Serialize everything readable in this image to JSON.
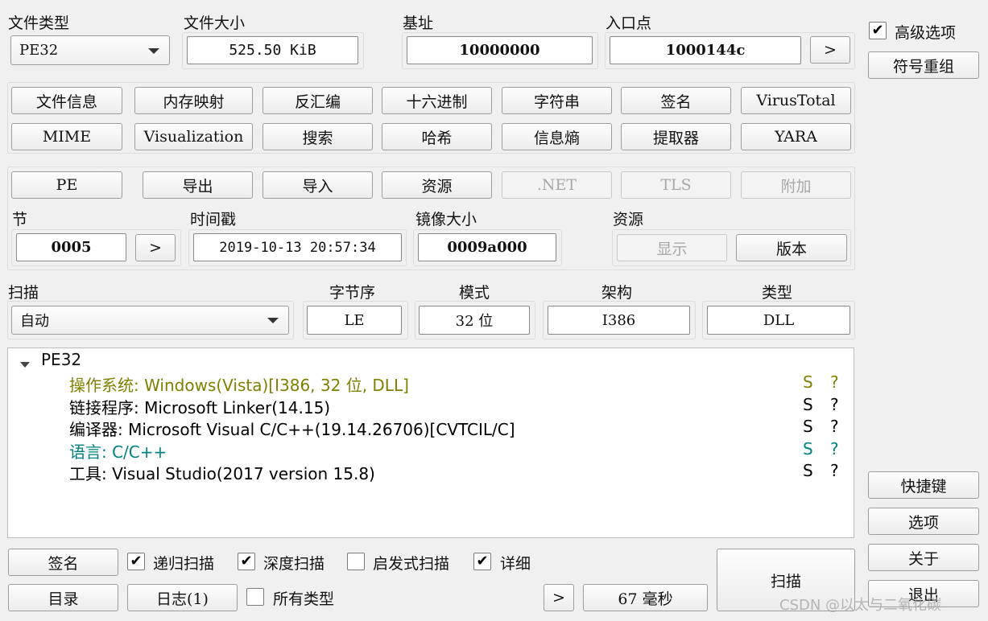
{
  "top": {
    "file_type_label": "文件类型",
    "file_type_value": "PE32",
    "file_size_label": "文件大小",
    "file_size_value": "525.50 KiB",
    "base_label": "基址",
    "base_value": "10000000",
    "entry_label": "入口点",
    "entry_value": "1000144c",
    "entry_go": ">"
  },
  "tools_row1": [
    "文件信息",
    "内存映射",
    "反汇编",
    "十六进制",
    "字符串",
    "签名",
    "VirusTotal"
  ],
  "tools_row2": [
    "MIME",
    "Visualization",
    "搜索",
    "哈希",
    "信息熵",
    "提取器",
    "YARA"
  ],
  "pe_row": {
    "pe": "PE",
    "export": "导出",
    "import": "导入",
    "resources": "资源",
    "net": ".NET",
    "tls": "TLS",
    "overlay": "附加"
  },
  "pe_info": {
    "section_label": "节",
    "section_value": "0005",
    "section_go": ">",
    "time_label": "时间戳",
    "time_value": "2019-10-13 20:57:34",
    "image_label": "镜像大小",
    "image_value": "0009a000",
    "res_label": "资源",
    "res_show": "显示",
    "res_version": "版本"
  },
  "scan": {
    "scan_label": "扫描",
    "scan_value": "自动",
    "endian_label": "字节序",
    "endian_value": "LE",
    "mode_label": "模式",
    "mode_value": "32 位",
    "arch_label": "架构",
    "arch_value": "I386",
    "type_label": "类型",
    "type_value": "DLL"
  },
  "tree": {
    "root": "PE32",
    "items": [
      {
        "text": "操作系统: Windows(Vista)[I386, 32 位, DLL]",
        "color": "#808000",
        "s": "S",
        "q": "?"
      },
      {
        "text": "链接程序: Microsoft Linker(14.15)",
        "color": "#000000",
        "s": "S",
        "q": "?"
      },
      {
        "text": "编译器: Microsoft Visual C/C++(19.14.26706)[CVTCIL/C]",
        "color": "#000000",
        "s": "S",
        "q": "?"
      },
      {
        "text": "语言: C/C++",
        "color": "#008080",
        "s": "S",
        "q": "?"
      },
      {
        "text": "工具: Visual Studio(2017 version 15.8)",
        "color": "#000000",
        "s": "S",
        "q": "?"
      }
    ]
  },
  "bottom": {
    "signature": "签名",
    "recursive": "递归扫描",
    "deep": "深度扫描",
    "heuristic": "启发式扫描",
    "verbose": "详细",
    "directory": "目录",
    "log": "日志(1)",
    "all_types": "所有类型",
    "go": ">",
    "time": "67 毫秒",
    "scan": "扫描",
    "check": "✔"
  },
  "side": {
    "advanced": "高级选项",
    "symbol": "符号重组",
    "shortcuts": "快捷键",
    "options": "选项",
    "about": "关于",
    "exit": "退出"
  },
  "watermark": "CSDN @以太与二氧化碳"
}
